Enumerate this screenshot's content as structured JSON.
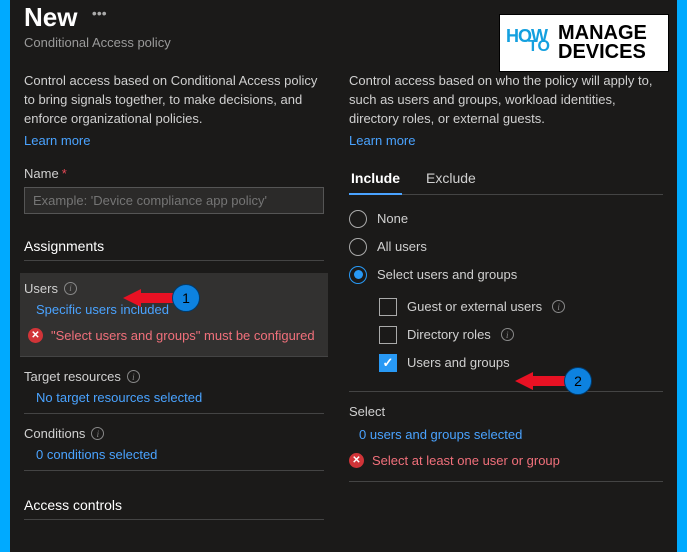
{
  "header": {
    "title": "New",
    "subtitle": "Conditional Access policy"
  },
  "left": {
    "desc": "Control access based on Conditional Access policy to bring signals together, to make decisions, and enforce organizational policies.",
    "learn": "Learn more",
    "name_label": "Name",
    "name_placeholder": "Example: 'Device compliance app policy'",
    "assignments_head": "Assignments",
    "users": {
      "title": "Users",
      "link": "Specific users included",
      "error": "\"Select users and groups\" must be configured"
    },
    "target": {
      "title": "Target resources",
      "link": "No target resources selected"
    },
    "conditions": {
      "title": "Conditions",
      "link": "0 conditions selected"
    },
    "access_head": "Access controls"
  },
  "right": {
    "desc": "Control access based on who the policy will apply to, such as users and groups, workload identities, directory roles, or external guests.",
    "learn": "Learn more",
    "tab_include": "Include",
    "tab_exclude": "Exclude",
    "opt_none": "None",
    "opt_all": "All users",
    "opt_select": "Select users and groups",
    "chk_guest": "Guest or external users",
    "chk_roles": "Directory roles",
    "chk_groups": "Users and groups",
    "select_label": "Select",
    "select_link": "0 users and groups selected",
    "select_error": "Select at least one user or group"
  },
  "logo": {
    "how": "HOW",
    "to": "TO",
    "manage": "MANAGE",
    "devices": "DEVICES"
  },
  "callouts": {
    "one": "1",
    "two": "2"
  }
}
